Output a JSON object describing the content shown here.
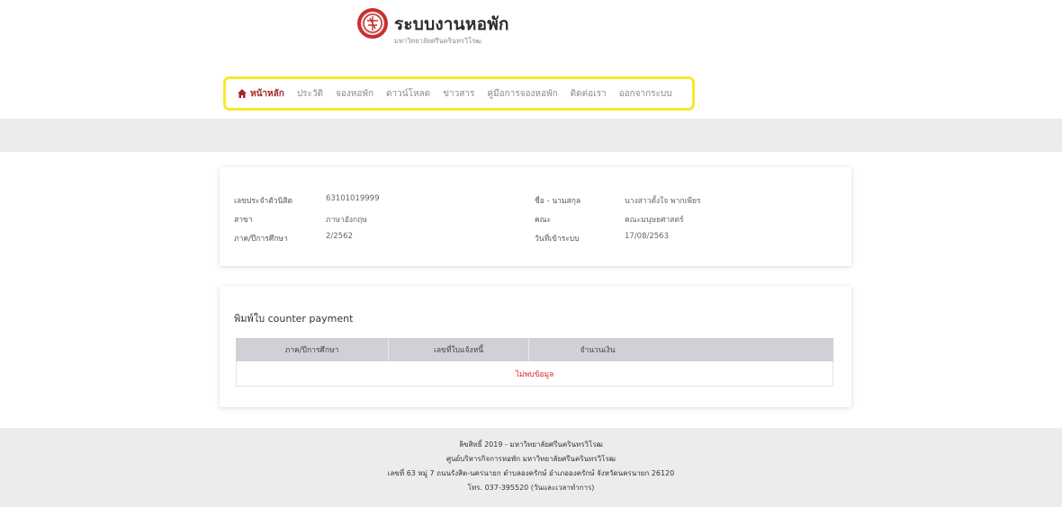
{
  "brand": {
    "title": "ระบบงานหอพัก",
    "subtitle": "มหาวิทยาลัยศรีนครินทรวิโรฒ"
  },
  "nav": {
    "items": [
      {
        "label": "หน้าหลัก",
        "active": true,
        "icon": "home-icon"
      },
      {
        "label": "ประวัติ"
      },
      {
        "label": "จองหอพัก"
      },
      {
        "label": "ดาวน์โหลด"
      },
      {
        "label": "ข่าวสาร"
      },
      {
        "label": "คู่มือการจองหอพัก"
      },
      {
        "label": "ติดต่อเรา"
      },
      {
        "label": "ออกจากระบบ"
      }
    ]
  },
  "student": {
    "id_label": "เลขประจำตัวนิสิต",
    "id_value": "63101019999",
    "major_label": "สาขา",
    "major_value": "ภาษาอังกฤษ",
    "term_label": "ภาค/ปีการศึกษา",
    "term_value": "2/2562",
    "name_label": "ชื่อ - นามสกุล",
    "name_value": "นางสาวตั้งใจ พากเพียร",
    "faculty_label": "คณะ",
    "faculty_value": "คณะมนุษยศาสตร์",
    "login_label": "วันที่เข้าระบบ",
    "login_value": "17/08/2563"
  },
  "payment": {
    "title": "พิมพ์ใบ counter payment",
    "columns": [
      "ภาค/ปีการศึกษา",
      "เลขที่ใบแจ้งหนี้",
      "จำนวนเงิน"
    ],
    "empty_text": "ไม่พบข้อมูล"
  },
  "footer": {
    "line1": "ลิขสิทธิ์ 2019 - มหาวิทยาลัยศรีนครินทรวิโรฒ",
    "line2": "ศูนย์บริหารกิจการหอพัก มหาวิทยาลัยศรีนครินทรวิโรฒ",
    "line3": "เลขที่ 63 หมู่ 7 ถนนรังสิต-นครนายก ตำบลองครักษ์ อำเภอองครักษ์ จังหวัดนครนายก 26120",
    "line4": "โทร. 037-395520 (วันและเวลาทำการ)"
  },
  "colors": {
    "accent": "#a62628",
    "nav_highlight": "#f4ea2c",
    "empty_text": "#d9262e",
    "band": "#ececec"
  }
}
